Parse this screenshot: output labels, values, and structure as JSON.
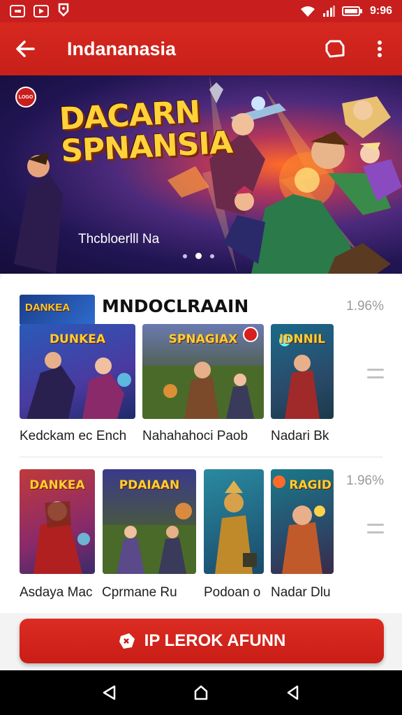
{
  "status_bar": {
    "time": "9:96",
    "left_icons": [
      "gallery-icon",
      "video-icon",
      "cast-icon"
    ],
    "right_icons": [
      "wifi-icon",
      "signal-icon",
      "battery-icon"
    ]
  },
  "app_bar": {
    "title": "Indananasia",
    "actions": [
      "tag-icon",
      "more-vert-icon"
    ]
  },
  "hero": {
    "title_line1": "DACARN",
    "title_line2": "SPNANSIA",
    "subtitle": "Thcbloerlll Na",
    "badge": "LOGO",
    "page_count": 3,
    "active_page": 2
  },
  "section1": {
    "thumb_text": "DANKEA",
    "title": "MNDOCLRAAIN",
    "side_value": "1.96%",
    "items": [
      {
        "banner": "DUNKEA",
        "label": "Kedckam ec Ench"
      },
      {
        "banner": "SPNAGIAX",
        "label": "Nahahahoci Paob"
      },
      {
        "banner": "IDNNIL",
        "label": "Nadari Bk"
      }
    ]
  },
  "section2": {
    "side_value": "1.96%",
    "items": [
      {
        "banner": "DANKEA",
        "label": "Asdaya Mac"
      },
      {
        "banner": "PDAIAAN",
        "label": "Cprmane Ru"
      },
      {
        "banner": "",
        "label": "Podoan o"
      },
      {
        "banner": "RAGID",
        "label": "Nadar Dlu"
      }
    ]
  },
  "cta": {
    "label": "IP LEROK AFUNN",
    "icon": "gamepad-icon"
  },
  "nav_bar": {
    "buttons": [
      "back-nav-icon",
      "home-nav-icon",
      "recents-nav-icon"
    ]
  },
  "colors": {
    "primary": "#c81e1e",
    "accent_gold": "#ffcf2e",
    "hero_bg": "#201552"
  }
}
